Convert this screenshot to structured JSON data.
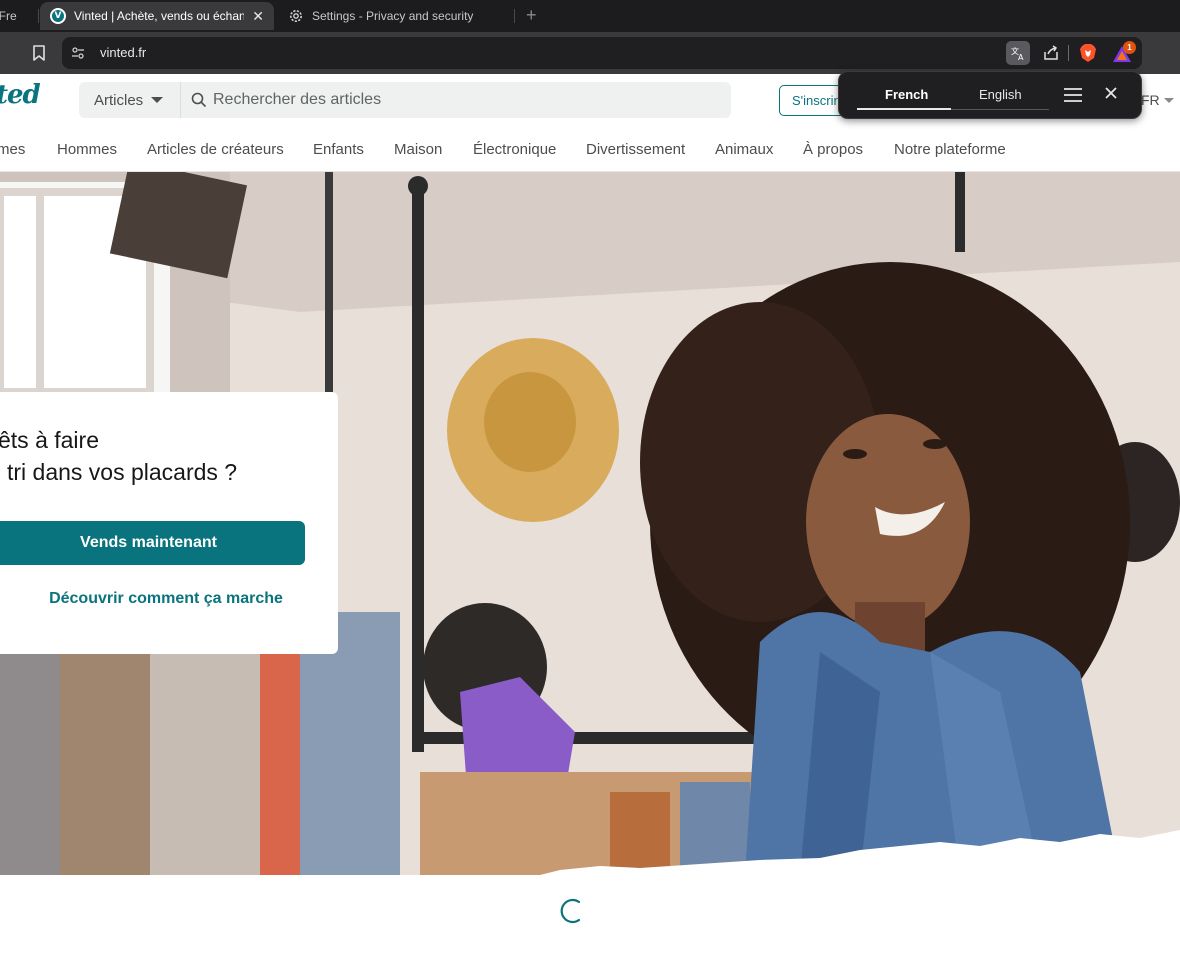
{
  "browser": {
    "tabs": [
      {
        "title": ": Fre",
        "state": "partial"
      },
      {
        "title": "Vinted | Achète, vends ou échange",
        "state": "active",
        "close": "✕"
      },
      {
        "title": "Settings - Privacy and security",
        "state": "inactive"
      }
    ],
    "new_tab": "+",
    "url": "vinted.fr",
    "rewards_badge": "1"
  },
  "header": {
    "logo": "ted",
    "search": {
      "category": "Articles",
      "placeholder": "Rechercher des articles"
    },
    "signup_label": "S'inscrire",
    "language": "FR"
  },
  "nav": {
    "items": [
      "mes",
      "Hommes",
      "Articles de créateurs",
      "Enfants",
      "Maison",
      "Électronique",
      "Divertissement",
      "Animaux",
      "À propos",
      "Notre plateforme"
    ]
  },
  "hero": {
    "title_line1": "Prêts à faire",
    "title_line2": "du tri dans vos placards ?",
    "cta": "Vends maintenant",
    "link": "Découvrir comment ça marche"
  },
  "translate_popup": {
    "source_lang": "French",
    "target_lang": "English",
    "close": "✕"
  },
  "colors": {
    "brand": "#09747d",
    "chrome_dark": "#1c1c1e",
    "chrome_toolbar": "#3a3a3d"
  }
}
